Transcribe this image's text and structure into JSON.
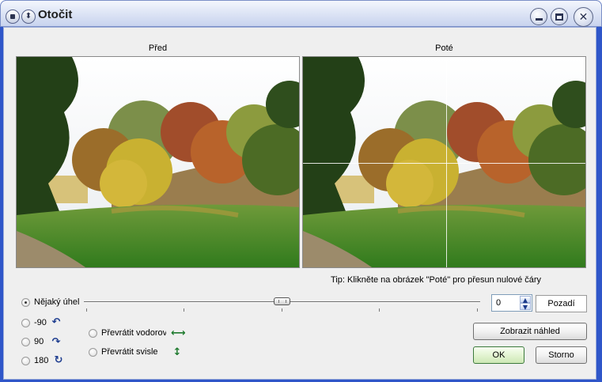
{
  "window": {
    "title": "Otočit",
    "menu_glyph": "⬍",
    "close_glyph": "✕"
  },
  "preview": {
    "before_label": "Před",
    "after_label": "Poté",
    "tip": "Tip: Klikněte na obrázek \"Poté\" pro přesun nulové čáry"
  },
  "options": {
    "angle_label": "Nějaký úhel",
    "angle_selected": true,
    "minus90_label": "-90",
    "plus90_label": "90",
    "deg180_label": "180",
    "flip_h_label": "Převrátit vodorovně",
    "flip_v_label": "Převrátit svisle"
  },
  "slider": {
    "value": 0
  },
  "spinner": {
    "value": "0",
    "up_glyph": "▲",
    "down_glyph": "▼"
  },
  "icons": {
    "rotate_ccw": "↶",
    "rotate_cw": "↷",
    "rotate_180": "↻",
    "flip_h": "⟷",
    "flip_v": "↕"
  },
  "buttons": {
    "background": "Pozadí",
    "show_preview": "Zobrazit náhled",
    "ok": "OK",
    "cancel": "Storno"
  },
  "colors": {
    "title_bar": "#dfe6f6",
    "ok_accent": "#cde8b4",
    "window_frame": "#2f56c9"
  }
}
